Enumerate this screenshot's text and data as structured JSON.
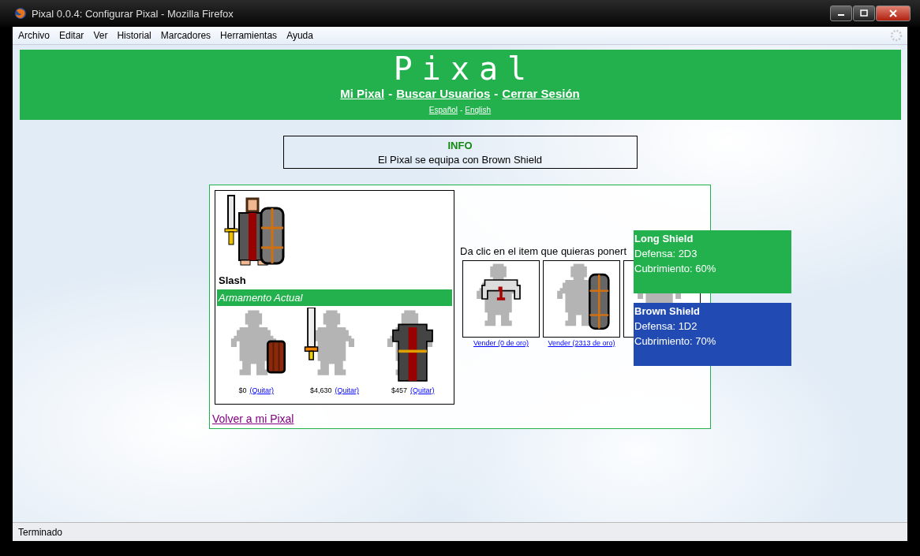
{
  "window": {
    "title": "Pixal 0.0.4: Configurar Pixal - Mozilla Firefox"
  },
  "menu": [
    "Archivo",
    "Editar",
    "Ver",
    "Historial",
    "Marcadores",
    "Herramientas",
    "Ayuda"
  ],
  "header": {
    "logo": "Pixal",
    "nav": [
      {
        "label": "Mi Pixal"
      },
      {
        "label": "Buscar Usuarios"
      },
      {
        "label": "Cerrar Sesión"
      }
    ],
    "nav_separator": "-",
    "languages": [
      {
        "label": "Español"
      },
      {
        "label": "English"
      }
    ],
    "language_separator": "-"
  },
  "info": {
    "title": "INFO",
    "message": "El Pixal se equipa con Brown Shield"
  },
  "character": {
    "name": "Slash",
    "section_title": "Armamento Actual",
    "equipped": [
      {
        "kind": "shield",
        "price": "$0",
        "action": "(Quitar)"
      },
      {
        "kind": "sword",
        "price": "$4,630",
        "action": "(Quitar)"
      },
      {
        "kind": "robe",
        "price": "$457",
        "action": "(Quitar)"
      }
    ]
  },
  "inventory": {
    "prompt": "Da clic en el item que quieras ponert",
    "items": [
      {
        "kind": "shirt",
        "action": "Vender (0 de oro)"
      },
      {
        "kind": "long-shield",
        "action": "Vender (2313 de oro)"
      },
      {
        "kind": "partial"
      }
    ]
  },
  "back_link": "Volver a mi Pixal",
  "tooltips": [
    {
      "name": "Long Shield",
      "lines": [
        "Defensa: 2D3",
        "Cubrimiento: 60%"
      ],
      "color": "#22b14c"
    },
    {
      "name": "Brown Shield",
      "lines": [
        "Defensa: 1D2",
        "Cubrimiento: 70%"
      ],
      "color": "#214bb3"
    }
  ],
  "status_bar": "Terminado"
}
